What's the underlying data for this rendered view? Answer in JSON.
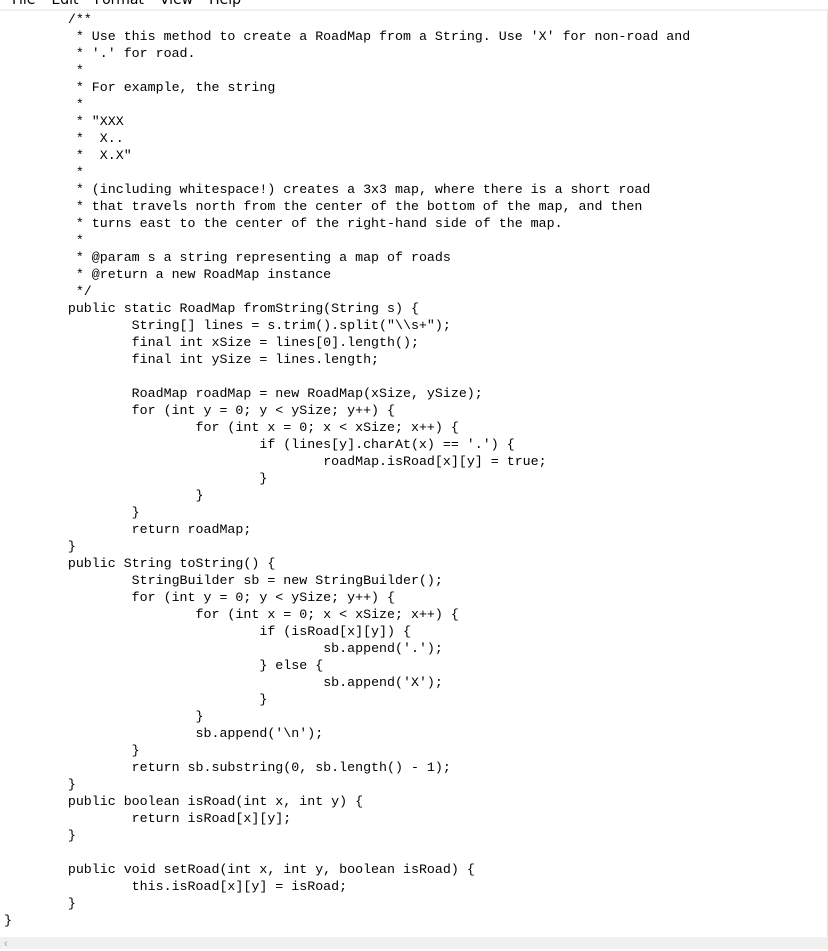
{
  "menu": {
    "items": [
      "File",
      "Edit",
      "Format",
      "View",
      "Help"
    ]
  },
  "editor": {
    "lines": [
      "\t/**",
      "\t * Use this method to create a RoadMap from a String. Use 'X' for non-road and",
      "\t * '.' for road.",
      "\t *",
      "\t * For example, the string",
      "\t *",
      "\t * \"XXX",
      "\t *  X..",
      "\t *  X.X\"",
      "\t *",
      "\t * (including whitespace!) creates a 3x3 map, where there is a short road",
      "\t * that travels north from the center of the bottom of the map, and then",
      "\t * turns east to the center of the right-hand side of the map.",
      "\t *",
      "\t * @param s a string representing a map of roads",
      "\t * @return a new RoadMap instance",
      "\t */",
      "\tpublic static RoadMap fromString(String s) {",
      "\t\tString[] lines = s.trim().split(\"\\\\s+\");",
      "\t\tfinal int xSize = lines[0].length();",
      "\t\tfinal int ySize = lines.length;",
      "",
      "\t\tRoadMap roadMap = new RoadMap(xSize, ySize);",
      "\t\tfor (int y = 0; y < ySize; y++) {",
      "\t\t\tfor (int x = 0; x < xSize; x++) {",
      "\t\t\t\tif (lines[y].charAt(x) == '.') {",
      "\t\t\t\t\troadMap.isRoad[x][y] = true;",
      "\t\t\t\t}",
      "\t\t\t}",
      "\t\t}",
      "\t\treturn roadMap;",
      "\t}",
      "\tpublic String toString() {",
      "\t\tStringBuilder sb = new StringBuilder();",
      "\t\tfor (int y = 0; y < ySize; y++) {",
      "\t\t\tfor (int x = 0; x < xSize; x++) {",
      "\t\t\t\tif (isRoad[x][y]) {",
      "\t\t\t\t\tsb.append('.');",
      "\t\t\t\t} else {",
      "\t\t\t\t\tsb.append('X');",
      "\t\t\t\t}",
      "\t\t\t}",
      "\t\t\tsb.append('\\n');",
      "\t\t}",
      "\t\treturn sb.substring(0, sb.length() - 1);",
      "\t}",
      "\tpublic boolean isRoad(int x, int y) {",
      "\t\treturn isRoad[x][y];",
      "\t}",
      "",
      "\tpublic void setRoad(int x, int y, boolean isRoad) {",
      "\t\tthis.isRoad[x][y] = isRoad;",
      "\t}",
      "}"
    ]
  },
  "scrollbar": {
    "left_arrow": "‹"
  }
}
